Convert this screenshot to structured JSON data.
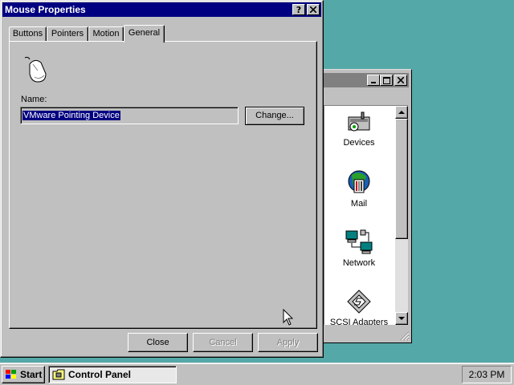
{
  "dialog": {
    "title": "Mouse Properties",
    "help_glyph": "?",
    "close_glyph": "✕",
    "tabs": [
      {
        "label": "Buttons"
      },
      {
        "label": "Pointers"
      },
      {
        "label": "Motion"
      },
      {
        "label": "General",
        "active": true
      }
    ],
    "general": {
      "name_label": "Name:",
      "name_value": "VMware Pointing Device",
      "change_button": "Change..."
    },
    "buttons": {
      "close": "Close",
      "cancel": "Cancel",
      "apply": "Apply"
    }
  },
  "control_panel": {
    "items": [
      {
        "label": "Devices",
        "icon": "devices-icon"
      },
      {
        "label": "Mail",
        "icon": "mail-icon"
      },
      {
        "label": "Network",
        "icon": "network-icon"
      },
      {
        "label": "SCSI Adapters",
        "icon": "scsi-adapters-icon"
      }
    ]
  },
  "taskbar": {
    "start_label": "Start",
    "task_label": "Control Panel",
    "clock": "2:03 PM"
  },
  "colors": {
    "desktop": "#55a8a8",
    "active_title": "#000080",
    "inactive_title": "#808080",
    "face": "#c0c0c0"
  }
}
